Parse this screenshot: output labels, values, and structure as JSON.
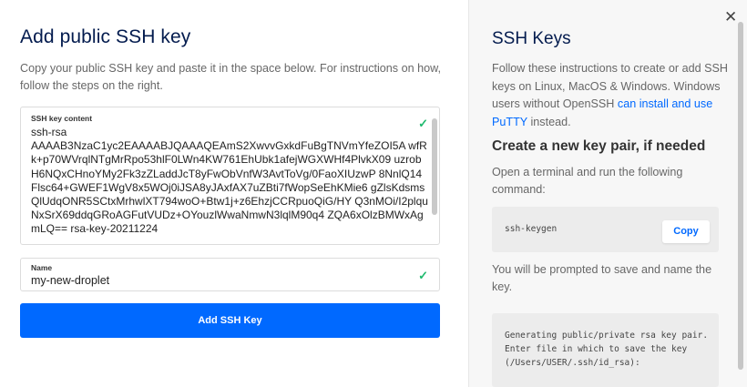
{
  "modal": {
    "title": "Add public SSH key",
    "intro": "Copy your public SSH key and paste it in the space below. For instructions on how, follow the steps on the right.",
    "key_field": {
      "label": "SSH key content",
      "value": "ssh-rsa\nAAAAB3NzaC1yc2EAAAABJQAAAQEAmS2XwvvGxkdFuBgTNVmYfeZOI5A wfRk+p70WVrqlNTgMrRpo53hlF0LWn4KW761EhUbk1afejWGXWHf4PlvkX09 uzrobH6NQxCHnoYMy2Fk3zZLaddJcT8yFwObVnfW3AvtToVg/0FaoXIUzwP 8NnlQ14Flsc64+GWEF1WgV8x5WOj0iJSA8yJAxfAX7uZBti7fWopSeEhKMie6 gZlsKdsmsQlUdqONR5SCtxMrhwlXT794woO+Btw1j+z6EhzjCCRpuoQiG/HY Q3nMOi/I2plquNxSrX69ddqGRoAGFutVUDz+OYouzlWwaNmwN3lqlM90q4 ZQA6xOlzBMWxAgmLQ== rsa-key-20211224",
      "check_icon": "check-icon"
    },
    "name_field": {
      "label": "Name",
      "value": "my-new-droplet",
      "check_icon": "check-icon"
    },
    "submit_label": "Add SSH Key",
    "close_icon": "close-icon",
    "colors": {
      "accent": "#0069ff",
      "check": "#1fba6e",
      "title": "#031b4e"
    }
  },
  "help": {
    "title": "SSH Keys",
    "intro_text": "Follow these instructions to create or add SSH keys on Linux, MacOS & Windows. Windows users without OpenSSH ",
    "intro_link": "can install and use PuTTY",
    "intro_tail": " instead.",
    "subtitle": "Create a new key pair, if needed",
    "step1": "Open a terminal and run the following command:",
    "command": "ssh-keygen",
    "copy_label": "Copy",
    "step2": "You will be prompted to save and name the key.",
    "output": "Generating public/private rsa key pair. Enter file in which to save the key (/Users/USER/.ssh/id_rsa):"
  }
}
